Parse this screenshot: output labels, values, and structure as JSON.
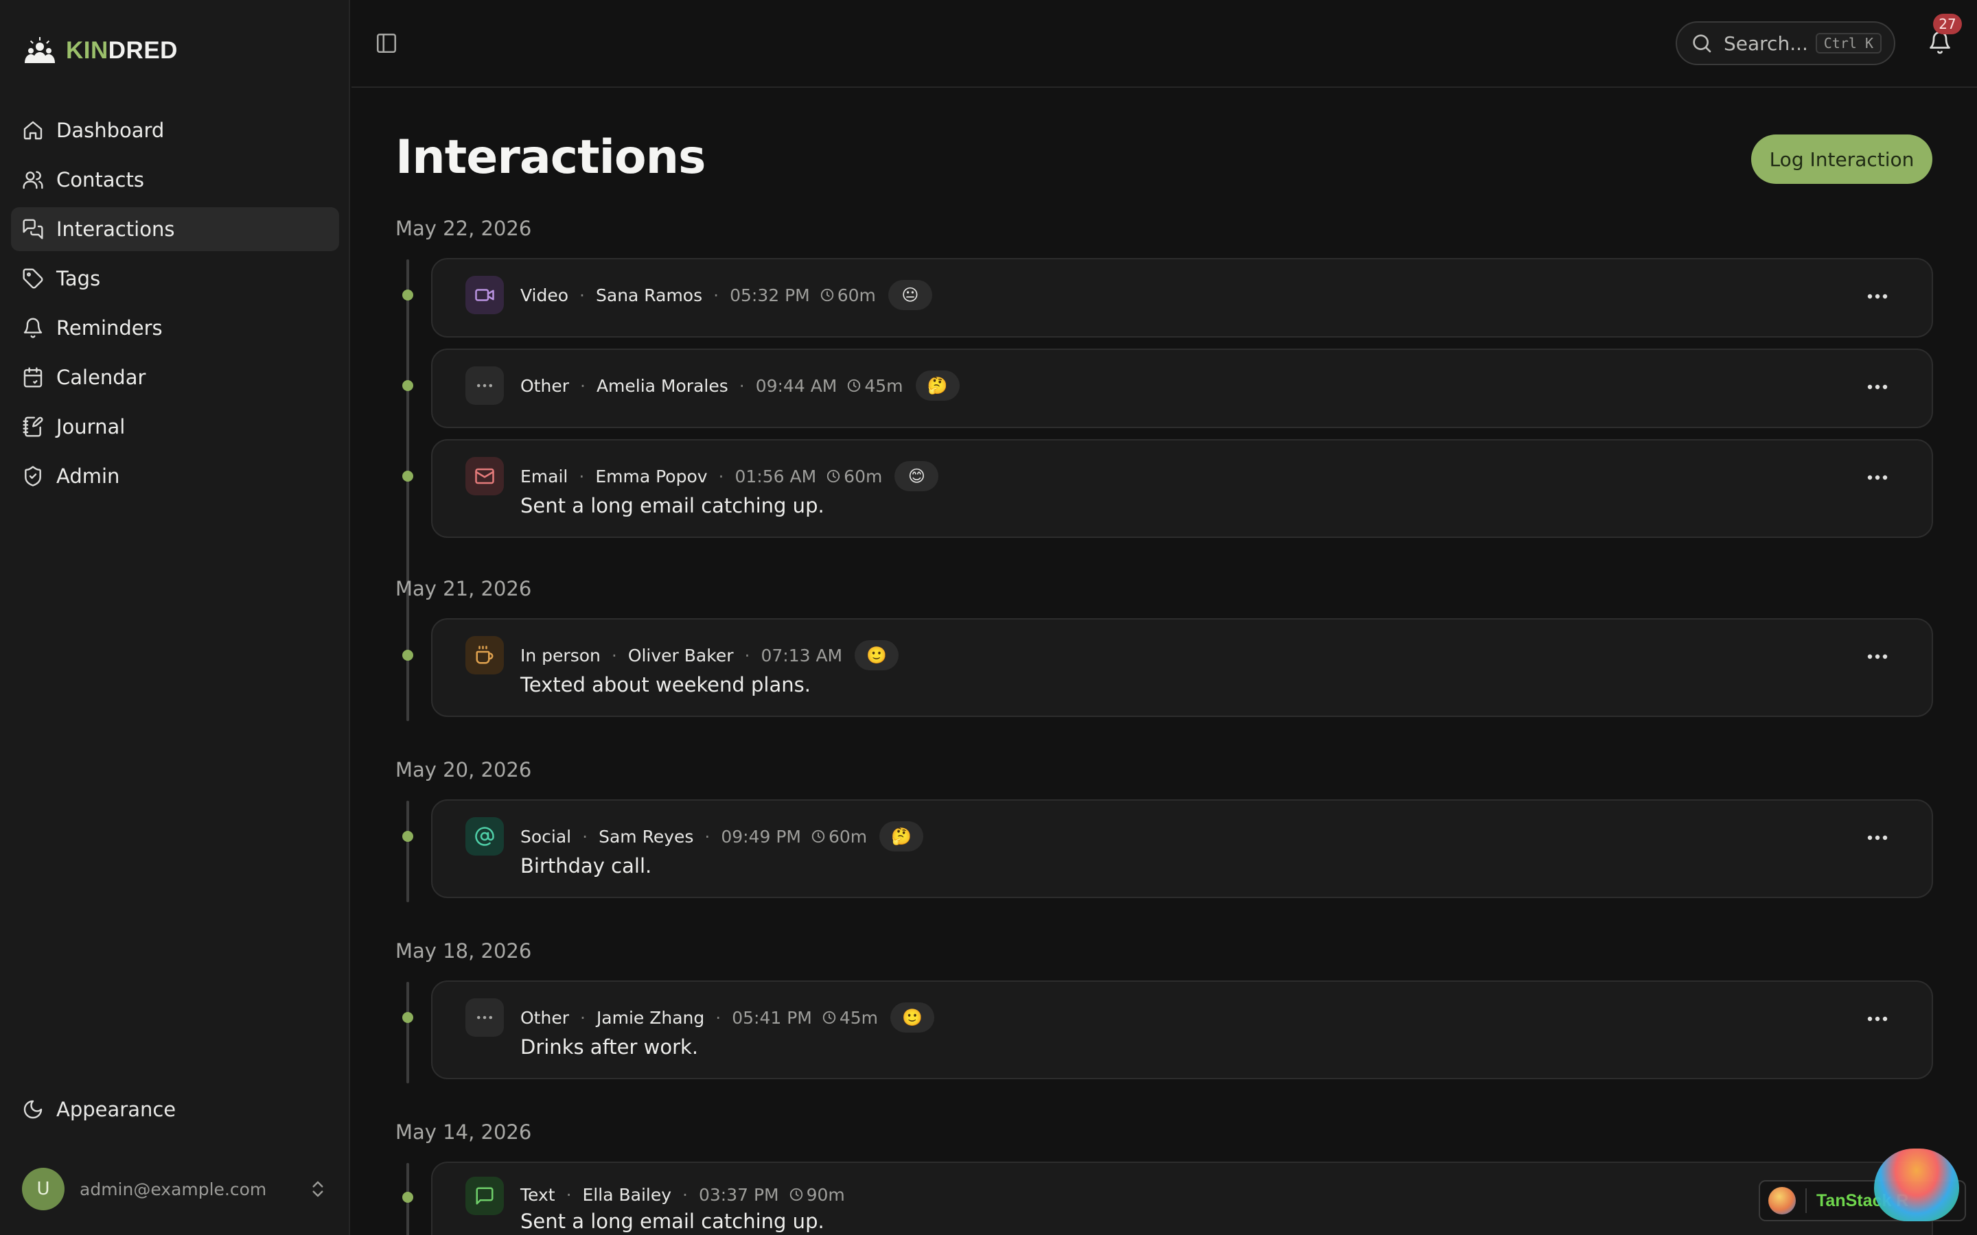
{
  "brand": {
    "kin": "KIN",
    "dred": "DRED"
  },
  "sidebar": {
    "items": [
      {
        "label": "Dashboard",
        "icon": "home-icon"
      },
      {
        "label": "Contacts",
        "icon": "users-icon"
      },
      {
        "label": "Interactions",
        "icon": "messages-icon",
        "active": true
      },
      {
        "label": "Tags",
        "icon": "tag-icon"
      },
      {
        "label": "Reminders",
        "icon": "bell-icon"
      },
      {
        "label": "Calendar",
        "icon": "calendar-icon"
      },
      {
        "label": "Journal",
        "icon": "notebook-pen-icon"
      },
      {
        "label": "Admin",
        "icon": "shield-icon"
      }
    ],
    "appearance_label": "Appearance",
    "user": {
      "initial": "U",
      "email": "admin@example.com"
    }
  },
  "topbar": {
    "search_placeholder": "Search...",
    "shortcut": "Ctrl K",
    "notification_count": "27"
  },
  "page": {
    "title": "Interactions",
    "log_button": "Log Interaction"
  },
  "groups": [
    {
      "date": "May 22, 2026",
      "entries": [
        {
          "type": "Video",
          "person": "Sana Ramos",
          "time": "05:32 PM",
          "duration": "60m",
          "mood": "😐",
          "note": "",
          "icon": "video-icon"
        },
        {
          "type": "Other",
          "person": "Amelia Morales",
          "time": "09:44 AM",
          "duration": "45m",
          "mood": "🤔",
          "note": "",
          "icon": "more-horizontal-icon"
        },
        {
          "type": "Email",
          "person": "Emma Popov",
          "time": "01:56 AM",
          "duration": "60m",
          "mood": "😊",
          "note": "Sent a long email catching up.",
          "icon": "mail-icon"
        }
      ]
    },
    {
      "date": "May 21, 2026",
      "entries": [
        {
          "type": "In person",
          "person": "Oliver Baker",
          "time": "07:13 AM",
          "duration": "",
          "mood": "🙂",
          "note": "Texted about weekend plans.",
          "icon": "coffee-icon"
        }
      ]
    },
    {
      "date": "May 20, 2026",
      "entries": [
        {
          "type": "Social",
          "person": "Sam Reyes",
          "time": "09:49 PM",
          "duration": "60m",
          "mood": "🤔",
          "note": "Birthday call.",
          "icon": "at-sign-icon"
        }
      ]
    },
    {
      "date": "May 18, 2026",
      "entries": [
        {
          "type": "Other",
          "person": "Jamie Zhang",
          "time": "05:41 PM",
          "duration": "45m",
          "mood": "🙂",
          "note": "Drinks after work.",
          "icon": "more-horizontal-icon"
        }
      ]
    },
    {
      "date": "May 14, 2026",
      "entries": [
        {
          "type": "Text",
          "person": "Ella Bailey",
          "time": "03:37 PM",
          "duration": "90m",
          "mood": "",
          "note": "Sent a long email catching up.",
          "icon": "message-square-icon"
        }
      ]
    }
  ],
  "devtools": {
    "label": "TanStack R"
  },
  "colors": {
    "accent": "#91b363",
    "background": "#121212",
    "sidebar": "#1a1a1a",
    "card": "#1b1b1b",
    "badge": "#b0393d"
  }
}
